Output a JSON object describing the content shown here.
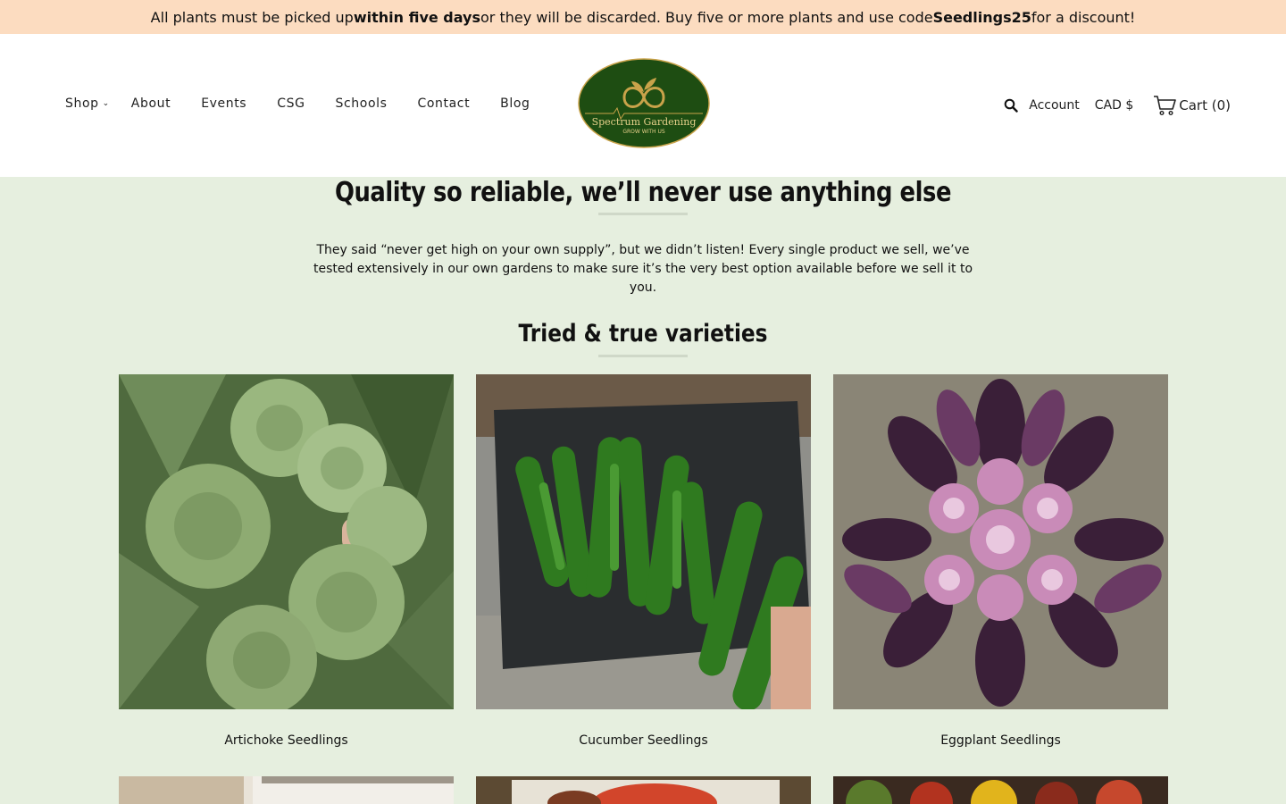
{
  "announcement": {
    "t1": "All plants must be picked up ",
    "b1": "within five days",
    "t2": " or they will be discarded. Buy five or more plants and use code ",
    "b2": "Seedlings25",
    "t3": " for a discount!"
  },
  "nav": {
    "shop": "Shop",
    "about": "About",
    "events": "Events",
    "csg": "CSG",
    "schools": "Schools",
    "contact": "Contact",
    "blog": "Blog"
  },
  "logo": {
    "name": "Spectrum Gardening",
    "tagline": "GROW WITH US"
  },
  "tools": {
    "account": "Account",
    "currency": "CAD $",
    "cart": "Cart (0)"
  },
  "hero": {
    "title": "Quality so reliable, we’ll never use anything else",
    "text": "They said “never get high on your own supply”, but we didn’t listen! Every single product we sell, we’ve tested extensively in our own gardens to make sure it’s the very best option available before we sell it to you."
  },
  "section": {
    "title": "Tried & true varieties"
  },
  "products": [
    {
      "name": "Artichoke Seedlings"
    },
    {
      "name": "Cucumber Seedlings"
    },
    {
      "name": "Eggplant Seedlings"
    }
  ],
  "colors": {
    "announce_bg": "#fcdcc0",
    "page_bg": "#e6efdf",
    "logo_green": "#1e4d12",
    "logo_gold": "#c9a34a"
  }
}
